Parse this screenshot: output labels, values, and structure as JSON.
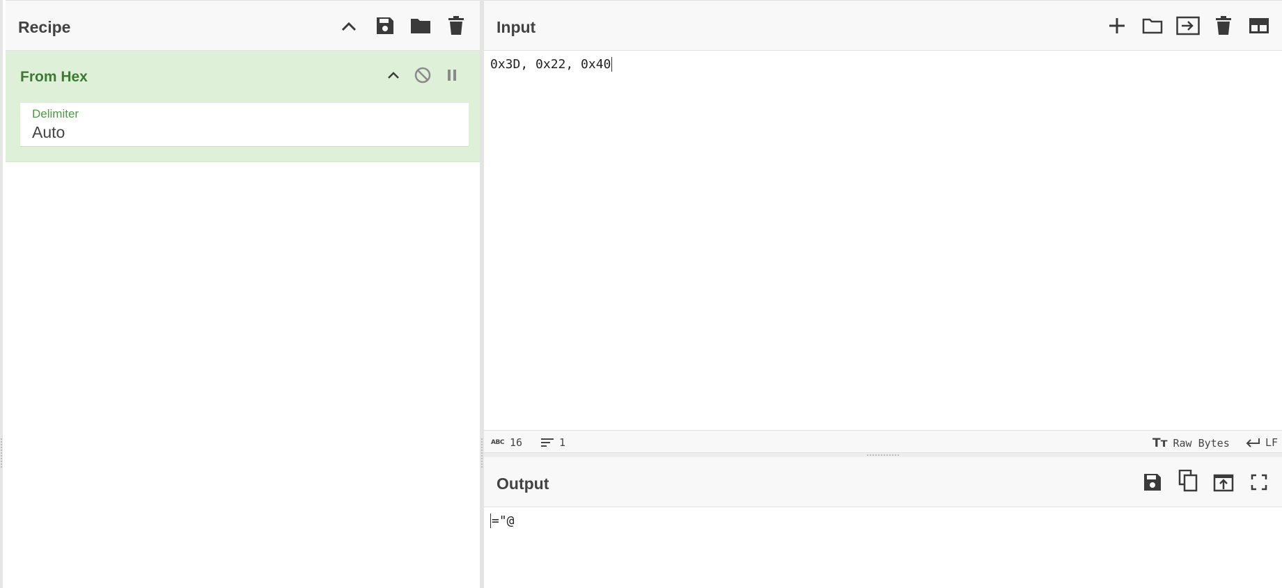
{
  "recipe": {
    "title": "Recipe",
    "icons": [
      "chevron-up-icon",
      "save-icon",
      "folder-icon",
      "trash-icon"
    ],
    "operation": {
      "name": "From Hex",
      "icons": [
        "chevron-up-icon",
        "disable-icon",
        "pause-icon"
      ],
      "delimiter": {
        "label": "Delimiter",
        "value": "Auto"
      }
    },
    "accent_color": "#3c7a32",
    "card_color": "#dff0d8"
  },
  "input": {
    "title": "Input",
    "icons": [
      "plus-icon",
      "folder-icon",
      "import-icon",
      "trash-icon",
      "layout-icon"
    ],
    "text": "0x3D, 0x22, 0x40",
    "status": {
      "char_count": "16",
      "line_count": "1",
      "encoding": "Raw Bytes",
      "eol": "LF"
    }
  },
  "output": {
    "title": "Output",
    "icons": [
      "save-icon",
      "copy-icon",
      "replace-input-icon",
      "fullscreen-icon"
    ],
    "text": "=\"@"
  }
}
